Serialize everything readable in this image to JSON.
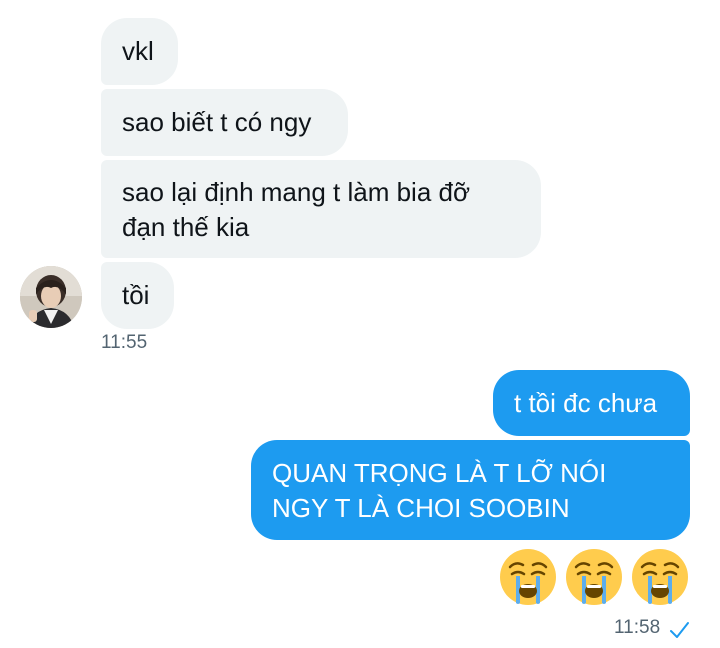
{
  "conversation": {
    "incoming": [
      {
        "text": "vkl"
      },
      {
        "text": "sao biết t có ngy"
      },
      {
        "line1": "sao lại định mang t làm bia đỡ",
        "line2": "đạn thế kia"
      },
      {
        "text": "tồi"
      }
    ],
    "incoming_time": "11:55",
    "outgoing": [
      {
        "text": "t tồi đc chưa"
      },
      {
        "line1": "QUAN TRỌNG LÀ T LỠ NÓI",
        "line2": "NGY T LÀ CHOI SOOBIN"
      }
    ],
    "outgoing_emojis": [
      "loudly-crying-face-icon",
      "loudly-crying-face-icon",
      "loudly-crying-face-icon"
    ],
    "outgoing_time": "11:58",
    "status_icon": "sent-check-icon"
  },
  "colors": {
    "incoming_bubble": "#eff3f4",
    "outgoing_bubble": "#1d9bf0",
    "timestamp": "#536471",
    "check": "#1d9bf0"
  }
}
